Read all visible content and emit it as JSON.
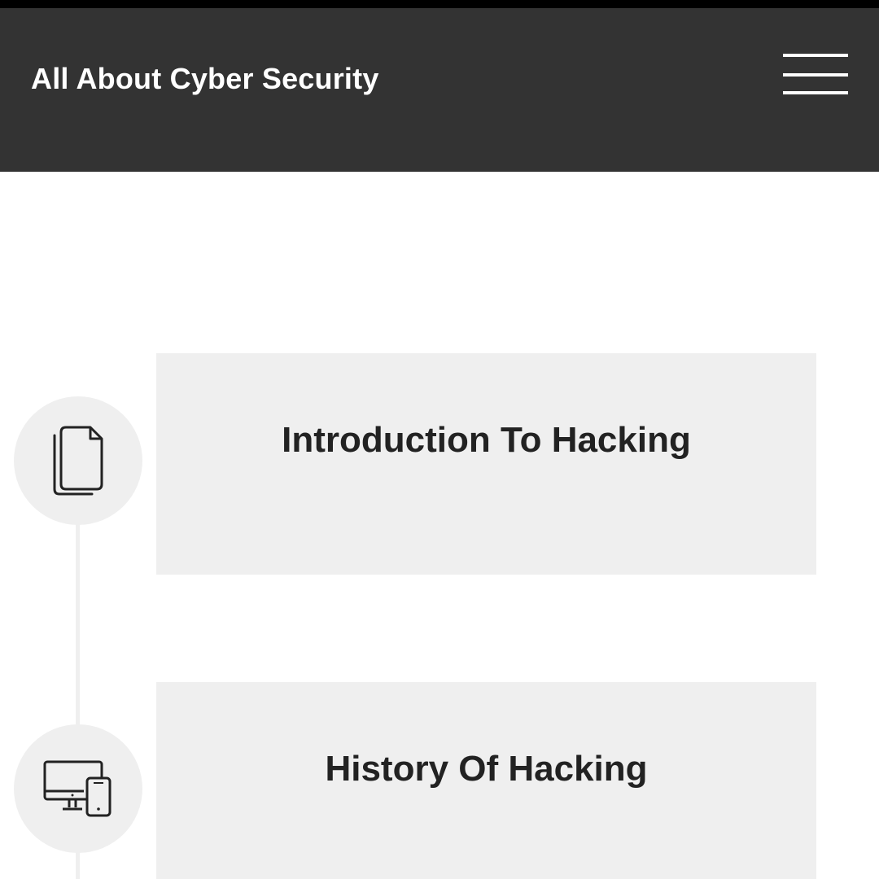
{
  "header": {
    "title": "All About Cyber Security",
    "menu_icon": "hamburger-menu-icon",
    "background_color": "#333333"
  },
  "timeline": {
    "items": [
      {
        "title": "Introduction To Hacking",
        "icon": "documents-icon"
      },
      {
        "title": "History Of Hacking",
        "icon": "devices-icon"
      }
    ]
  },
  "colors": {
    "card_background": "#efefef",
    "text": "#222222",
    "header_text": "#ffffff"
  }
}
